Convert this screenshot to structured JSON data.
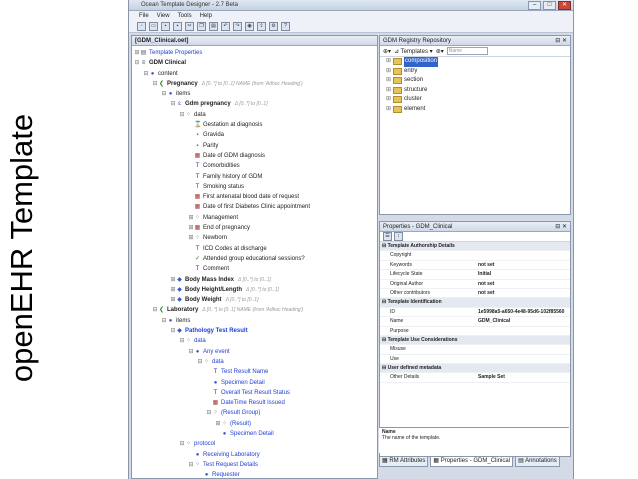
{
  "slide_title": "openEHR Template",
  "window": {
    "title": "Ocean Template Designer - 2.7 Beta",
    "menu": [
      "File",
      "View",
      "Tools",
      "Help"
    ]
  },
  "left_tab": "[GDM_Clinical.oet]",
  "tree": [
    {
      "d": 0,
      "e": "+",
      "i": "doc",
      "t": "Template Properties",
      "c": "blue"
    },
    {
      "d": 0,
      "e": "-",
      "i": "tpl",
      "t": "GDM Clinical",
      "b": true
    },
    {
      "d": 1,
      "e": "-",
      "i": "circle",
      "t": "content"
    },
    {
      "d": 2,
      "e": "-",
      "i": "sec",
      "t": "Pregnancy",
      "b": true,
      "n": "Δ  [0..*] to [0..1]  NAME (from 'Adhoc Heading')"
    },
    {
      "d": 3,
      "e": "-",
      "i": "circle",
      "t": "items"
    },
    {
      "d": 4,
      "e": "-",
      "i": "eval",
      "t": "Gdm pregnancy",
      "b": true,
      "n": "Δ  [0..*] to [0..1]"
    },
    {
      "d": 5,
      "e": "-",
      "i": "dots",
      "t": "data"
    },
    {
      "d": 6,
      "e": "",
      "i": "hour",
      "t": "Gestation at diagnosis"
    },
    {
      "d": 6,
      "e": "",
      "i": "q",
      "t": "Gravida"
    },
    {
      "d": 6,
      "e": "",
      "i": "q",
      "t": "Parity"
    },
    {
      "d": 6,
      "e": "",
      "i": "cal",
      "t": "Date of GDM diagnosis"
    },
    {
      "d": 6,
      "e": "",
      "i": "T",
      "t": "Comorbidities"
    },
    {
      "d": 6,
      "e": "",
      "i": "T",
      "t": "Family history of GDM"
    },
    {
      "d": 6,
      "e": "",
      "i": "T",
      "t": "Smoking status"
    },
    {
      "d": 6,
      "e": "",
      "i": "cal",
      "t": "First antenatal blood date of request"
    },
    {
      "d": 6,
      "e": "",
      "i": "cal",
      "t": "Date of first Diabetes Clinic appointment"
    },
    {
      "d": 6,
      "e": "+",
      "i": "dots",
      "t": "Management"
    },
    {
      "d": 6,
      "e": "+",
      "i": "cal",
      "t": "End of pregnancy"
    },
    {
      "d": 6,
      "e": "+",
      "i": "dots",
      "t": "Newborn"
    },
    {
      "d": 6,
      "e": "",
      "i": "T",
      "t": "ICD Codes at discharge"
    },
    {
      "d": 6,
      "e": "",
      "i": "check",
      "t": "Attended group educational sessions?"
    },
    {
      "d": 6,
      "e": "",
      "i": "T",
      "t": "Comment"
    },
    {
      "d": 4,
      "e": "+",
      "i": "obs",
      "t": "Body Mass Index",
      "b": true,
      "n": "Δ  [0..*] to [0..1]"
    },
    {
      "d": 4,
      "e": "+",
      "i": "obs",
      "t": "Body Height/Length",
      "b": true,
      "n": "Δ  [0..*] to [0..1]"
    },
    {
      "d": 4,
      "e": "+",
      "i": "obs",
      "t": "Body Weight",
      "b": true,
      "n": "Δ  [0..*] to [0..1]"
    },
    {
      "d": 2,
      "e": "-",
      "i": "sec",
      "t": "Laboratory",
      "b": true,
      "n": "Δ  [0..*] to [0..1]  NAME (from 'Adhoc Heading')"
    },
    {
      "d": 3,
      "e": "-",
      "i": "circle",
      "t": "items"
    },
    {
      "d": 4,
      "e": "-",
      "i": "obs",
      "t": "Pathology Test Result",
      "b": true,
      "c": "blue"
    },
    {
      "d": 5,
      "e": "-",
      "i": "dots",
      "t": "data",
      "c": "blue"
    },
    {
      "d": 6,
      "e": "-",
      "i": "circle",
      "t": "Any event",
      "c": "blue"
    },
    {
      "d": 7,
      "e": "-",
      "i": "dots",
      "t": "data",
      "c": "blue"
    },
    {
      "d": 8,
      "e": "",
      "i": "T",
      "t": "Test Result Name",
      "c": "blue"
    },
    {
      "d": 8,
      "e": "",
      "i": "circle",
      "t": "Specimen Detail",
      "c": "blue"
    },
    {
      "d": 8,
      "e": "",
      "i": "T",
      "t": "Overall Test Result Status",
      "c": "blue"
    },
    {
      "d": 8,
      "e": "",
      "i": "cal",
      "t": "DateTime Result Issued",
      "c": "blue"
    },
    {
      "d": 8,
      "e": "-",
      "i": "dots",
      "t": "(Result Group)",
      "c": "blue"
    },
    {
      "d": 9,
      "e": "+",
      "i": "dots",
      "t": "(Result)",
      "c": "blue"
    },
    {
      "d": 9,
      "e": "",
      "i": "circle",
      "t": "Specimen Detail",
      "c": "blue"
    },
    {
      "d": 5,
      "e": "-",
      "i": "dots",
      "t": "protocol",
      "c": "blue"
    },
    {
      "d": 6,
      "e": "",
      "i": "circle",
      "t": "Receiving Laboratory",
      "c": "blue"
    },
    {
      "d": 6,
      "e": "-",
      "i": "dots",
      "t": "Test Request Details",
      "c": "blue"
    },
    {
      "d": 7,
      "e": "",
      "i": "circle",
      "t": "Requester",
      "c": "blue"
    }
  ],
  "registry": {
    "header": "GDM Registry Repository",
    "dropdown": "Templates",
    "search_placeholder": "Name",
    "items": [
      "composition",
      "entry",
      "section",
      "structure",
      "cluster",
      "element"
    ]
  },
  "properties": {
    "header": "Properties - GDM_Clinical",
    "rows": [
      {
        "cat": true,
        "k": "Template Authorship Details",
        "v": ""
      },
      {
        "k": "Copyright",
        "v": ""
      },
      {
        "k": "Keywords",
        "v": "not set"
      },
      {
        "k": "Lifecycle State",
        "v": "Initial"
      },
      {
        "k": "Original Author",
        "v": "not set"
      },
      {
        "k": "Other contributors",
        "v": "not set"
      },
      {
        "cat": true,
        "k": "Template Identification",
        "v": ""
      },
      {
        "k": "ID",
        "v": "1e5998a5-a650-4e48-95d6-102f85560"
      },
      {
        "k": "Name",
        "v": "GDM_Clinical"
      },
      {
        "k": "Purpose",
        "v": ""
      },
      {
        "cat": true,
        "k": "Template Use Considerations",
        "v": ""
      },
      {
        "k": "Misuse",
        "v": ""
      },
      {
        "k": "Use",
        "v": ""
      },
      {
        "cat": true,
        "k": "User defined metadata",
        "v": ""
      },
      {
        "k": "Other Details",
        "v": "Sample Set"
      }
    ],
    "desc_title": "Name",
    "desc_text": "The name of the template."
  },
  "bottom_tabs": [
    "RM Attributes",
    "Properties - GDM_Clinical",
    "Annotations"
  ]
}
